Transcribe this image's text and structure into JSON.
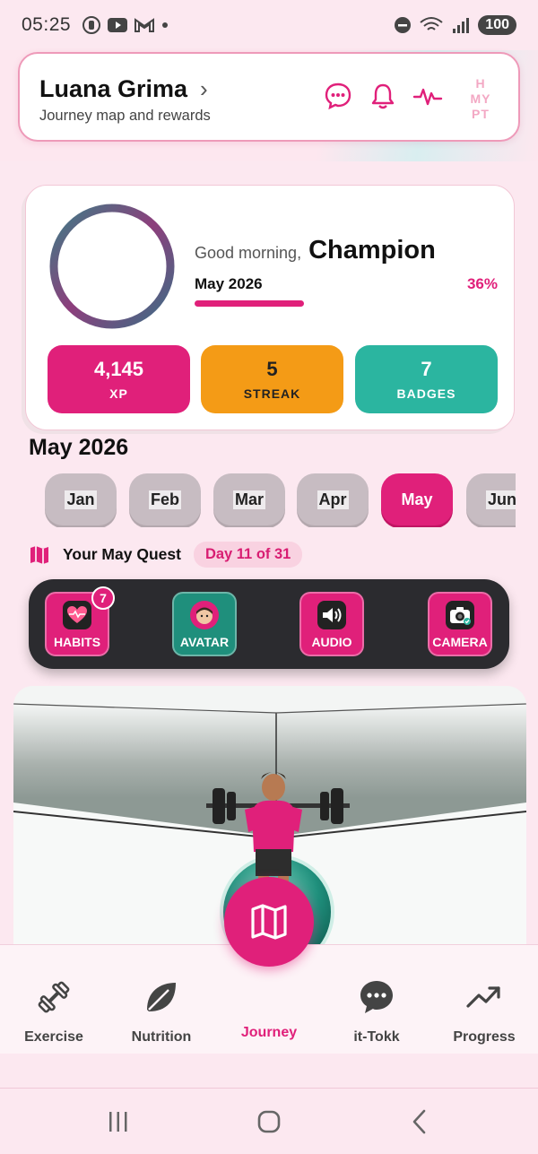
{
  "status_bar": {
    "time": "05:25",
    "battery": "100"
  },
  "header": {
    "name": "Luana Grima",
    "subtitle": "Journey map and rewards",
    "chevron": "›",
    "icons": [
      "chat-icon",
      "bell-icon",
      "heartbeat-icon"
    ],
    "logo_lines": [
      "H",
      "MY",
      "PT"
    ]
  },
  "profile": {
    "greeting": "Good morning,",
    "nickname": "Champion",
    "month_label": "May 2026",
    "month_progress_percent": 36,
    "month_progress_text": "36%",
    "stats": [
      {
        "value": "4,145",
        "label": "XP",
        "color": "#e0207a"
      },
      {
        "value": "5",
        "label": "STREAK",
        "color": "#f49b16"
      },
      {
        "value": "7",
        "label": "BADGES",
        "color": "#2bb5a0"
      }
    ]
  },
  "calendar": {
    "title": "May 2026",
    "months": [
      "Jan",
      "Feb",
      "Mar",
      "Apr",
      "May",
      "Jun"
    ],
    "selected": "May"
  },
  "quest": {
    "title": "Your May Quest",
    "day_badge": "Day 11 of 31"
  },
  "actions": [
    {
      "label": "HABITS",
      "icon": "heart-pulse-icon",
      "color": "#e0207a",
      "badge": "7"
    },
    {
      "label": "AVATAR",
      "icon": "avatar-icon",
      "color": "#1f8f7c"
    },
    {
      "label": "AUDIO",
      "icon": "speaker-icon",
      "color": "#e0207a"
    },
    {
      "label": "CAMERA",
      "icon": "camera-icon",
      "color": "#e0207a"
    }
  ],
  "nav": {
    "items": [
      {
        "label": "Exercise",
        "icon": "dumbbell-icon"
      },
      {
        "label": "Nutrition",
        "icon": "leaf-icon"
      },
      {
        "label": "Journey",
        "icon": "map-icon"
      },
      {
        "label": "it-Tokk",
        "icon": "chat-bubble-icon"
      },
      {
        "label": "Progress",
        "icon": "trend-up-icon"
      }
    ],
    "active": "Journey"
  }
}
